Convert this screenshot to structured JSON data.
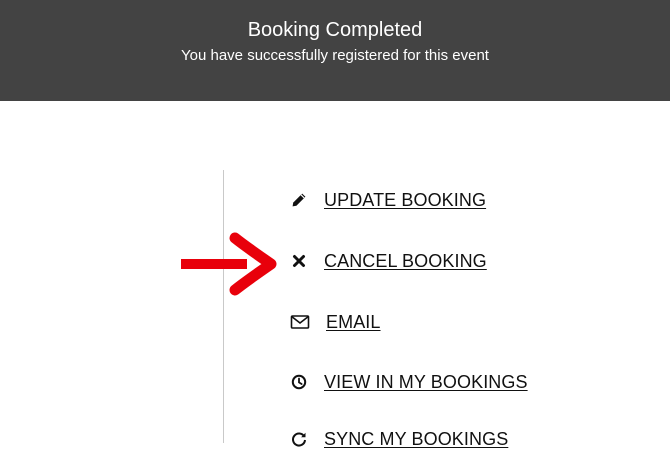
{
  "banner": {
    "title": "Booking Completed",
    "subtitle": "You have successfully registered for this event"
  },
  "actions": [
    {
      "label": "UPDATE BOOKING",
      "icon": "pencil-icon"
    },
    {
      "label": "CANCEL BOOKING",
      "icon": "close-icon"
    },
    {
      "label": "EMAIL",
      "icon": "envelope-icon"
    },
    {
      "label": "VIEW IN MY BOOKINGS",
      "icon": "clock-icon"
    },
    {
      "label": "SYNC MY BOOKINGS",
      "icon": "refresh-icon"
    }
  ],
  "annotation": {
    "arrow_color": "#e8000b",
    "arrow_icon": "red-arrow-icon"
  },
  "colors": {
    "banner_bg": "#434343",
    "banner_text": "#ffffff",
    "link_text": "#111111",
    "divider": "#c9c9c9"
  }
}
